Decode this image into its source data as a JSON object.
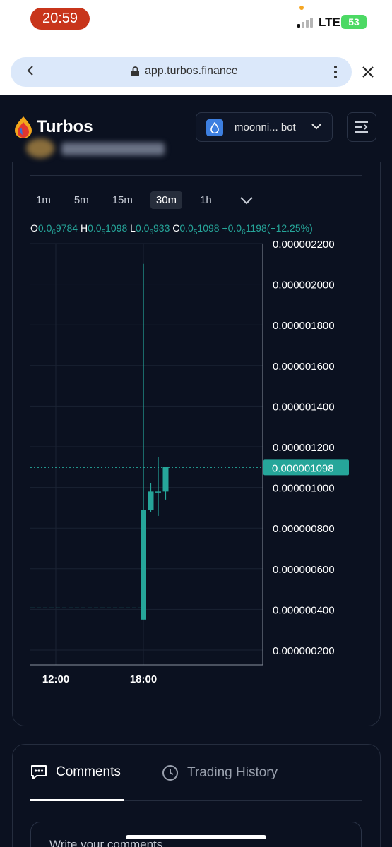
{
  "status": {
    "time": "20:59",
    "network": "LTE",
    "battery": "53"
  },
  "browser": {
    "url": "app.turbos.finance"
  },
  "header": {
    "brand": "Turbos",
    "wallet_label": "moonni... bot"
  },
  "timeframes": [
    {
      "label": "1m",
      "active": false
    },
    {
      "label": "5m",
      "active": false
    },
    {
      "label": "15m",
      "active": false
    },
    {
      "label": "30m",
      "active": true
    },
    {
      "label": "1h",
      "active": false
    }
  ],
  "ohlc": {
    "o_label": "O",
    "o_a": "0.0",
    "o_sub": "6",
    "o_b": "9784",
    "h_label": "H",
    "h_a": "0.0",
    "h_sub": "5",
    "h_b": "1098",
    "l_label": "L",
    "l_a": "0.0",
    "l_sub": "6",
    "l_b": "933",
    "c_label": "C",
    "c_a": "0.0",
    "c_sub": "5",
    "c_b": "1098",
    "chg_a": "+0.0",
    "chg_sub": "6",
    "chg_b": "1198(+12.25%)"
  },
  "chart_data": {
    "type": "candlestick",
    "y_ticks": [
      "0.000002200",
      "0.000002000",
      "0.000001800",
      "0.000001600",
      "0.000001400",
      "0.000001200",
      "0.000001000",
      "0.000000800",
      "0.000000600",
      "0.000000400",
      "0.000000200"
    ],
    "x_ticks": [
      "12:00",
      "18:00"
    ],
    "last_price_label": "0.000001098",
    "last_price": 1.098e-06,
    "reference_line": 4e-07,
    "ylim": [
      2e-07,
      2.2e-06
    ],
    "candles": [
      {
        "x": "18:00",
        "open": 3.5e-07,
        "high": 2.1e-06,
        "low": 3.5e-07,
        "close": 8.9e-07
      },
      {
        "x": "18:30",
        "open": 8.9e-07,
        "high": 1.02e-06,
        "low": 8.8e-07,
        "close": 9.8e-07
      },
      {
        "x": "19:00",
        "open": 9.8e-07,
        "high": 1.15e-06,
        "low": 8.6e-07,
        "close": 9.8e-07
      },
      {
        "x": "19:30",
        "open": 9.8e-07,
        "high": 1.1e-06,
        "low": 9.4e-07,
        "close": 1.1e-06
      }
    ],
    "up_color": "#26a69a"
  },
  "tabs": {
    "comments": "Comments",
    "history": "Trading History"
  },
  "comment_placeholder": "Write your comments"
}
